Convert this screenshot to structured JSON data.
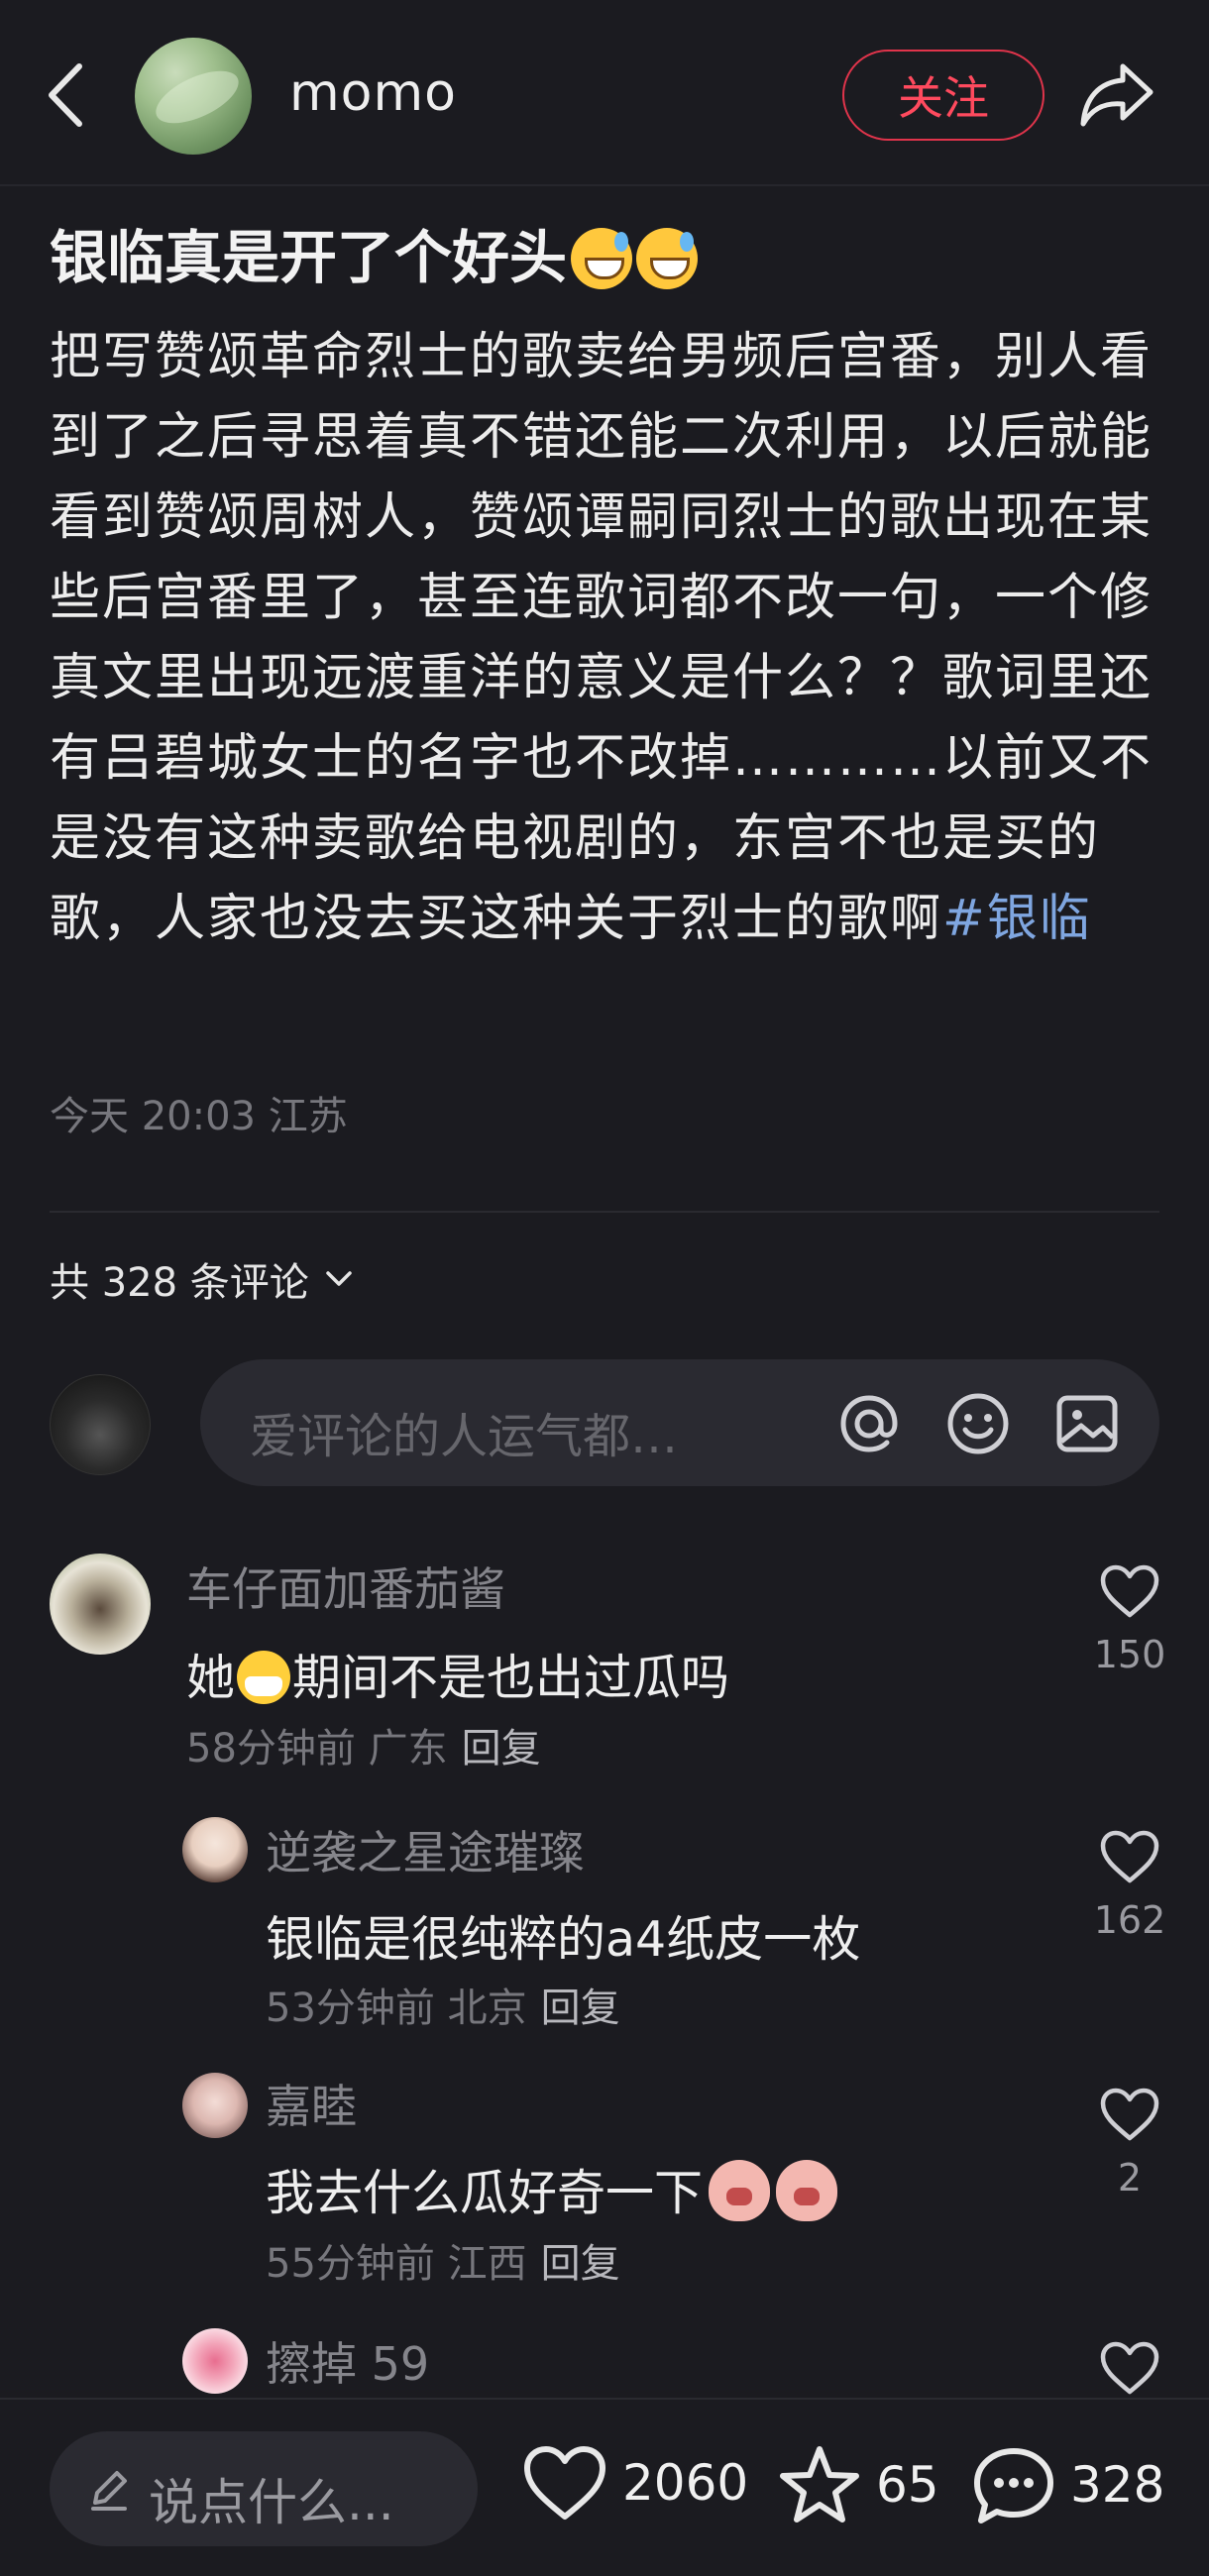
{
  "header": {
    "author_name": "momo",
    "follow_label": "关注",
    "icons": [
      "back-icon",
      "share-icon"
    ]
  },
  "post": {
    "title": "银临真是开了个好头",
    "body": "把写赞颂革命烈士的歌卖给男频后宫番，别人看到了之后寻思着真不错还能二次利用，以后就能看到赞颂周树人，赞颂谭嗣同烈士的歌出现在某些后宫番里了，甚至连歌词都不改一句，一个修真文里出现远渡重洋的意义是什么？？歌词里还有吕碧城女士的名字也不改掉…………以前又不是没有这种卖歌给电视剧的，东宫不也是买的歌，人家也没去买这种关于烈士的歌啊",
    "hashtag": "#银临",
    "meta": "今天 20:03 江苏"
  },
  "comments_section": {
    "count_label": "共 328 条评论",
    "input_placeholder": "爱评论的人运气都…",
    "comments": [
      {
        "name": "车仔面加番茄酱",
        "text_before": "她",
        "text_after": "期间不是也出过瓜吗",
        "time_location": "58分钟前 广东",
        "reply_label": "回复",
        "likes": "150"
      },
      {
        "name": "逆袭之星途璀璨",
        "text": "银临是很纯粹的a4纸皮一枚",
        "time_location": "53分钟前 北京",
        "reply_label": "回复",
        "likes": "162"
      },
      {
        "name": "嘉睦",
        "text": "我去什么瓜好奇一下",
        "time_location": "55分钟前 江西",
        "reply_label": "回复",
        "likes": "2"
      },
      {
        "name": "擦掉 59"
      }
    ]
  },
  "bottom_bar": {
    "input_placeholder": "说点什么...",
    "likes": "2060",
    "favorites": "65",
    "comments": "328"
  },
  "colors": {
    "background": "#1b1b20",
    "accent_red": "#ff4a5e",
    "hashtag_blue": "#7fa6e0",
    "muted_text": "#77777d"
  }
}
